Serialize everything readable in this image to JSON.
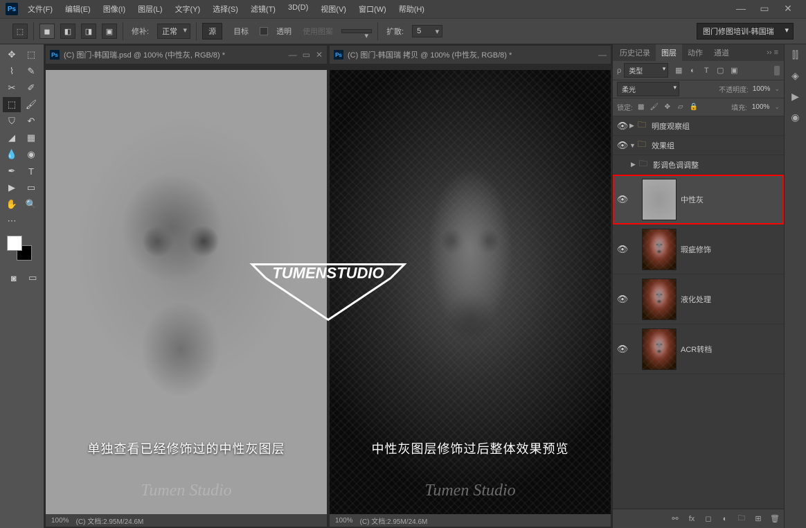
{
  "app": {
    "logo": "Ps"
  },
  "menu": [
    "文件(F)",
    "编辑(E)",
    "图像(I)",
    "图层(L)",
    "文字(Y)",
    "选择(S)",
    "滤镜(T)",
    "3D(D)",
    "视图(V)",
    "窗口(W)",
    "帮助(H)"
  ],
  "options": {
    "repair_label": "修补:",
    "repair_mode": "正常",
    "source": "源",
    "target": "目标",
    "transparent": "透明",
    "use_pattern": "使用图案",
    "diffusion_label": "扩散:",
    "diffusion_value": "5"
  },
  "workspace": "图门修图培训-韩国瑞",
  "docs": [
    {
      "title": "(C) 图门-韩国瑞.psd @ 100% (中性灰, RGB/8) *",
      "caption": "单独查看已经修饰过的中性灰图层",
      "studio": "Tumen Studio",
      "zoom": "100%",
      "status": "(C) 文档:2.95M/24.6M"
    },
    {
      "title": "(C) 图门-韩国瑞 拷贝 @ 100% (中性灰, RGB/8) *",
      "caption": "中性灰图层修饰过后整体效果预览",
      "studio": "Tumen Studio",
      "zoom": "100%",
      "status": "(C) 文档:2.95M/24.6M"
    }
  ],
  "watermark": "TUMENSTUDIO",
  "panels": {
    "tabs": {
      "history": "历史记录",
      "layers": "图层",
      "actions": "动作",
      "channels": "通道"
    },
    "filter_label": "类型",
    "blend_mode": "柔光",
    "opacity_label": "不透明度:",
    "opacity_value": "100%",
    "lock_label": "锁定:",
    "fill_label": "填充:",
    "fill_value": "100%",
    "groups": [
      {
        "name": "明度观察组"
      },
      {
        "name": "效果组"
      }
    ],
    "sub_layer": "影调色调调整",
    "layers": [
      {
        "name": "中性灰",
        "highlighted": true,
        "thumb": "gray"
      },
      {
        "name": "瑕疵修饰",
        "thumb": "portrait"
      },
      {
        "name": "液化处理",
        "thumb": "portrait"
      },
      {
        "name": "ACR转档",
        "thumb": "portrait"
      }
    ]
  },
  "search_placeholder": "ρ"
}
